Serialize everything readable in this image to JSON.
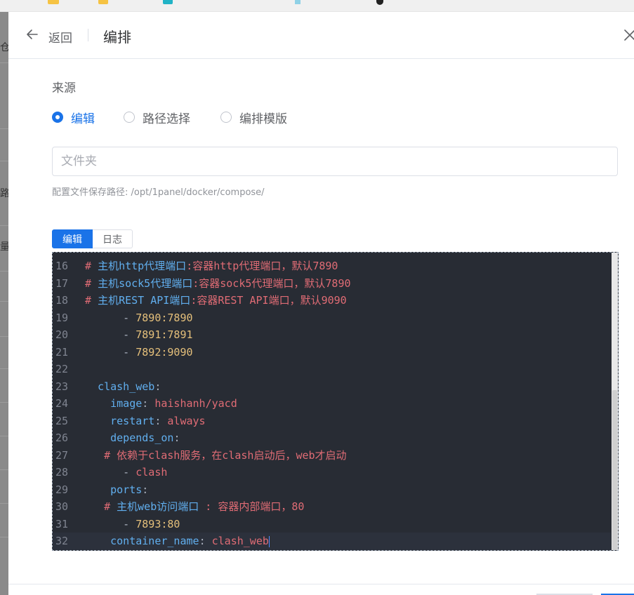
{
  "header": {
    "back_label": "返回",
    "title": "编排"
  },
  "source": {
    "label": "来源",
    "options": [
      {
        "label": "编辑",
        "checked": true
      },
      {
        "label": "路径选择",
        "checked": false
      },
      {
        "label": "编排模版",
        "checked": false
      }
    ]
  },
  "folder": {
    "placeholder": "文件夹",
    "value": ""
  },
  "hint": "配置文件保存路径: /opt/1panel/docker/compose/",
  "tabs": [
    "编辑",
    "日志"
  ],
  "editor": {
    "lines": [
      {
        "n": "16",
        "tokens": [
          {
            "t": "# ",
            "c": "cm"
          },
          {
            "t": "主机http代理端口",
            "c": "cmb"
          },
          {
            "t": ":容器http代理端口，默认7890",
            "c": "cm"
          }
        ]
      },
      {
        "n": "17",
        "tokens": [
          {
            "t": "# ",
            "c": "cm"
          },
          {
            "t": "主机sock5代理端口",
            "c": "cmb"
          },
          {
            "t": ":容器sock5代理端口，默认7890",
            "c": "cm"
          }
        ]
      },
      {
        "n": "18",
        "tokens": [
          {
            "t": "# ",
            "c": "cm"
          },
          {
            "t": "主机REST API端口",
            "c": "cmb"
          },
          {
            "t": ":容器REST API端口，默认9090",
            "c": "cm"
          }
        ]
      },
      {
        "n": "19",
        "tokens": [
          {
            "t": "      - ",
            "c": "punc"
          },
          {
            "t": "7890:7890",
            "c": "num"
          }
        ]
      },
      {
        "n": "20",
        "tokens": [
          {
            "t": "      - ",
            "c": "punc"
          },
          {
            "t": "7891:7891",
            "c": "num"
          }
        ]
      },
      {
        "n": "21",
        "tokens": [
          {
            "t": "      - ",
            "c": "punc"
          },
          {
            "t": "7892:9090",
            "c": "num"
          }
        ]
      },
      {
        "n": "22",
        "tokens": []
      },
      {
        "n": "23",
        "tokens": [
          {
            "t": "  clash_web",
            "c": "key"
          },
          {
            "t": ":",
            "c": "punc"
          }
        ]
      },
      {
        "n": "24",
        "tokens": [
          {
            "t": "    image",
            "c": "key"
          },
          {
            "t": ": ",
            "c": "punc"
          },
          {
            "t": "haishanh/yacd",
            "c": "str"
          }
        ]
      },
      {
        "n": "25",
        "tokens": [
          {
            "t": "    restart",
            "c": "key"
          },
          {
            "t": ": ",
            "c": "punc"
          },
          {
            "t": "always",
            "c": "str"
          }
        ]
      },
      {
        "n": "26",
        "tokens": [
          {
            "t": "    depends_on",
            "c": "key"
          },
          {
            "t": ":",
            "c": "punc"
          }
        ]
      },
      {
        "n": "27",
        "tokens": [
          {
            "t": "   # 依赖于clash服务，在clash启动后，web才启动",
            "c": "cm"
          }
        ]
      },
      {
        "n": "28",
        "tokens": [
          {
            "t": "      - ",
            "c": "punc"
          },
          {
            "t": "clash",
            "c": "str"
          }
        ]
      },
      {
        "n": "29",
        "tokens": [
          {
            "t": "    ports",
            "c": "key"
          },
          {
            "t": ":",
            "c": "punc"
          }
        ]
      },
      {
        "n": "30",
        "tokens": [
          {
            "t": "   # ",
            "c": "cm"
          },
          {
            "t": "主机web访问端口",
            "c": "cmb"
          },
          {
            "t": " : 容器内部端口，80",
            "c": "cm"
          }
        ]
      },
      {
        "n": "31",
        "tokens": [
          {
            "t": "      - ",
            "c": "punc"
          },
          {
            "t": "7893:80",
            "c": "num"
          }
        ]
      },
      {
        "n": "32",
        "tokens": [
          {
            "t": "    container_name",
            "c": "key"
          },
          {
            "t": ": ",
            "c": "punc"
          },
          {
            "t": "clash_web",
            "c": "str"
          }
        ],
        "active": true
      }
    ]
  },
  "left_backdrop_chars": [
    "仓",
    "路",
    "量"
  ]
}
